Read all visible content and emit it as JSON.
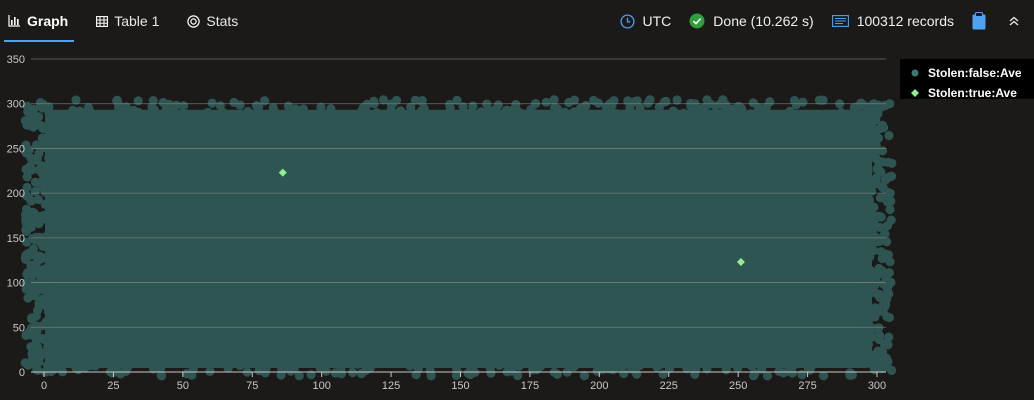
{
  "tabs": [
    {
      "label": "Graph",
      "icon": "bar-chart-icon",
      "active": true
    },
    {
      "label": "Table 1",
      "icon": "table-icon",
      "active": false
    },
    {
      "label": "Stats",
      "icon": "stats-icon",
      "active": false
    }
  ],
  "status": {
    "timezone": "UTC",
    "done": "Done (10.262 s)",
    "records": "100312 records"
  },
  "colors": {
    "accent": "#4ea1f3",
    "done_green": "#2e9e3e",
    "series_false": "#2e5552",
    "series_true": "#90ee90"
  },
  "chart_data": {
    "type": "scatter",
    "xlim": [
      0,
      300
    ],
    "ylim": [
      0,
      350
    ],
    "x_ticks": [
      "0",
      "25",
      "50",
      "75",
      "100",
      "125",
      "150",
      "175",
      "200",
      "225",
      "250",
      "275",
      "300"
    ],
    "y_ticks": [
      "0",
      "50",
      "100",
      "150",
      "200",
      "250",
      "300",
      "350"
    ],
    "grid": true,
    "legend_position": "top-right",
    "series": [
      {
        "name": "Stolen:false:Ave",
        "color": "#2e5552",
        "marker": "circle",
        "dense_region": {
          "x": [
            0,
            300
          ],
          "y": [
            0,
            300
          ]
        },
        "points": []
      },
      {
        "name": "Stolen:true:Ave",
        "color": "#90ee90",
        "marker": "diamond",
        "points": [
          {
            "x": 86,
            "y": 223
          },
          {
            "x": 251,
            "y": 123
          }
        ]
      }
    ]
  }
}
